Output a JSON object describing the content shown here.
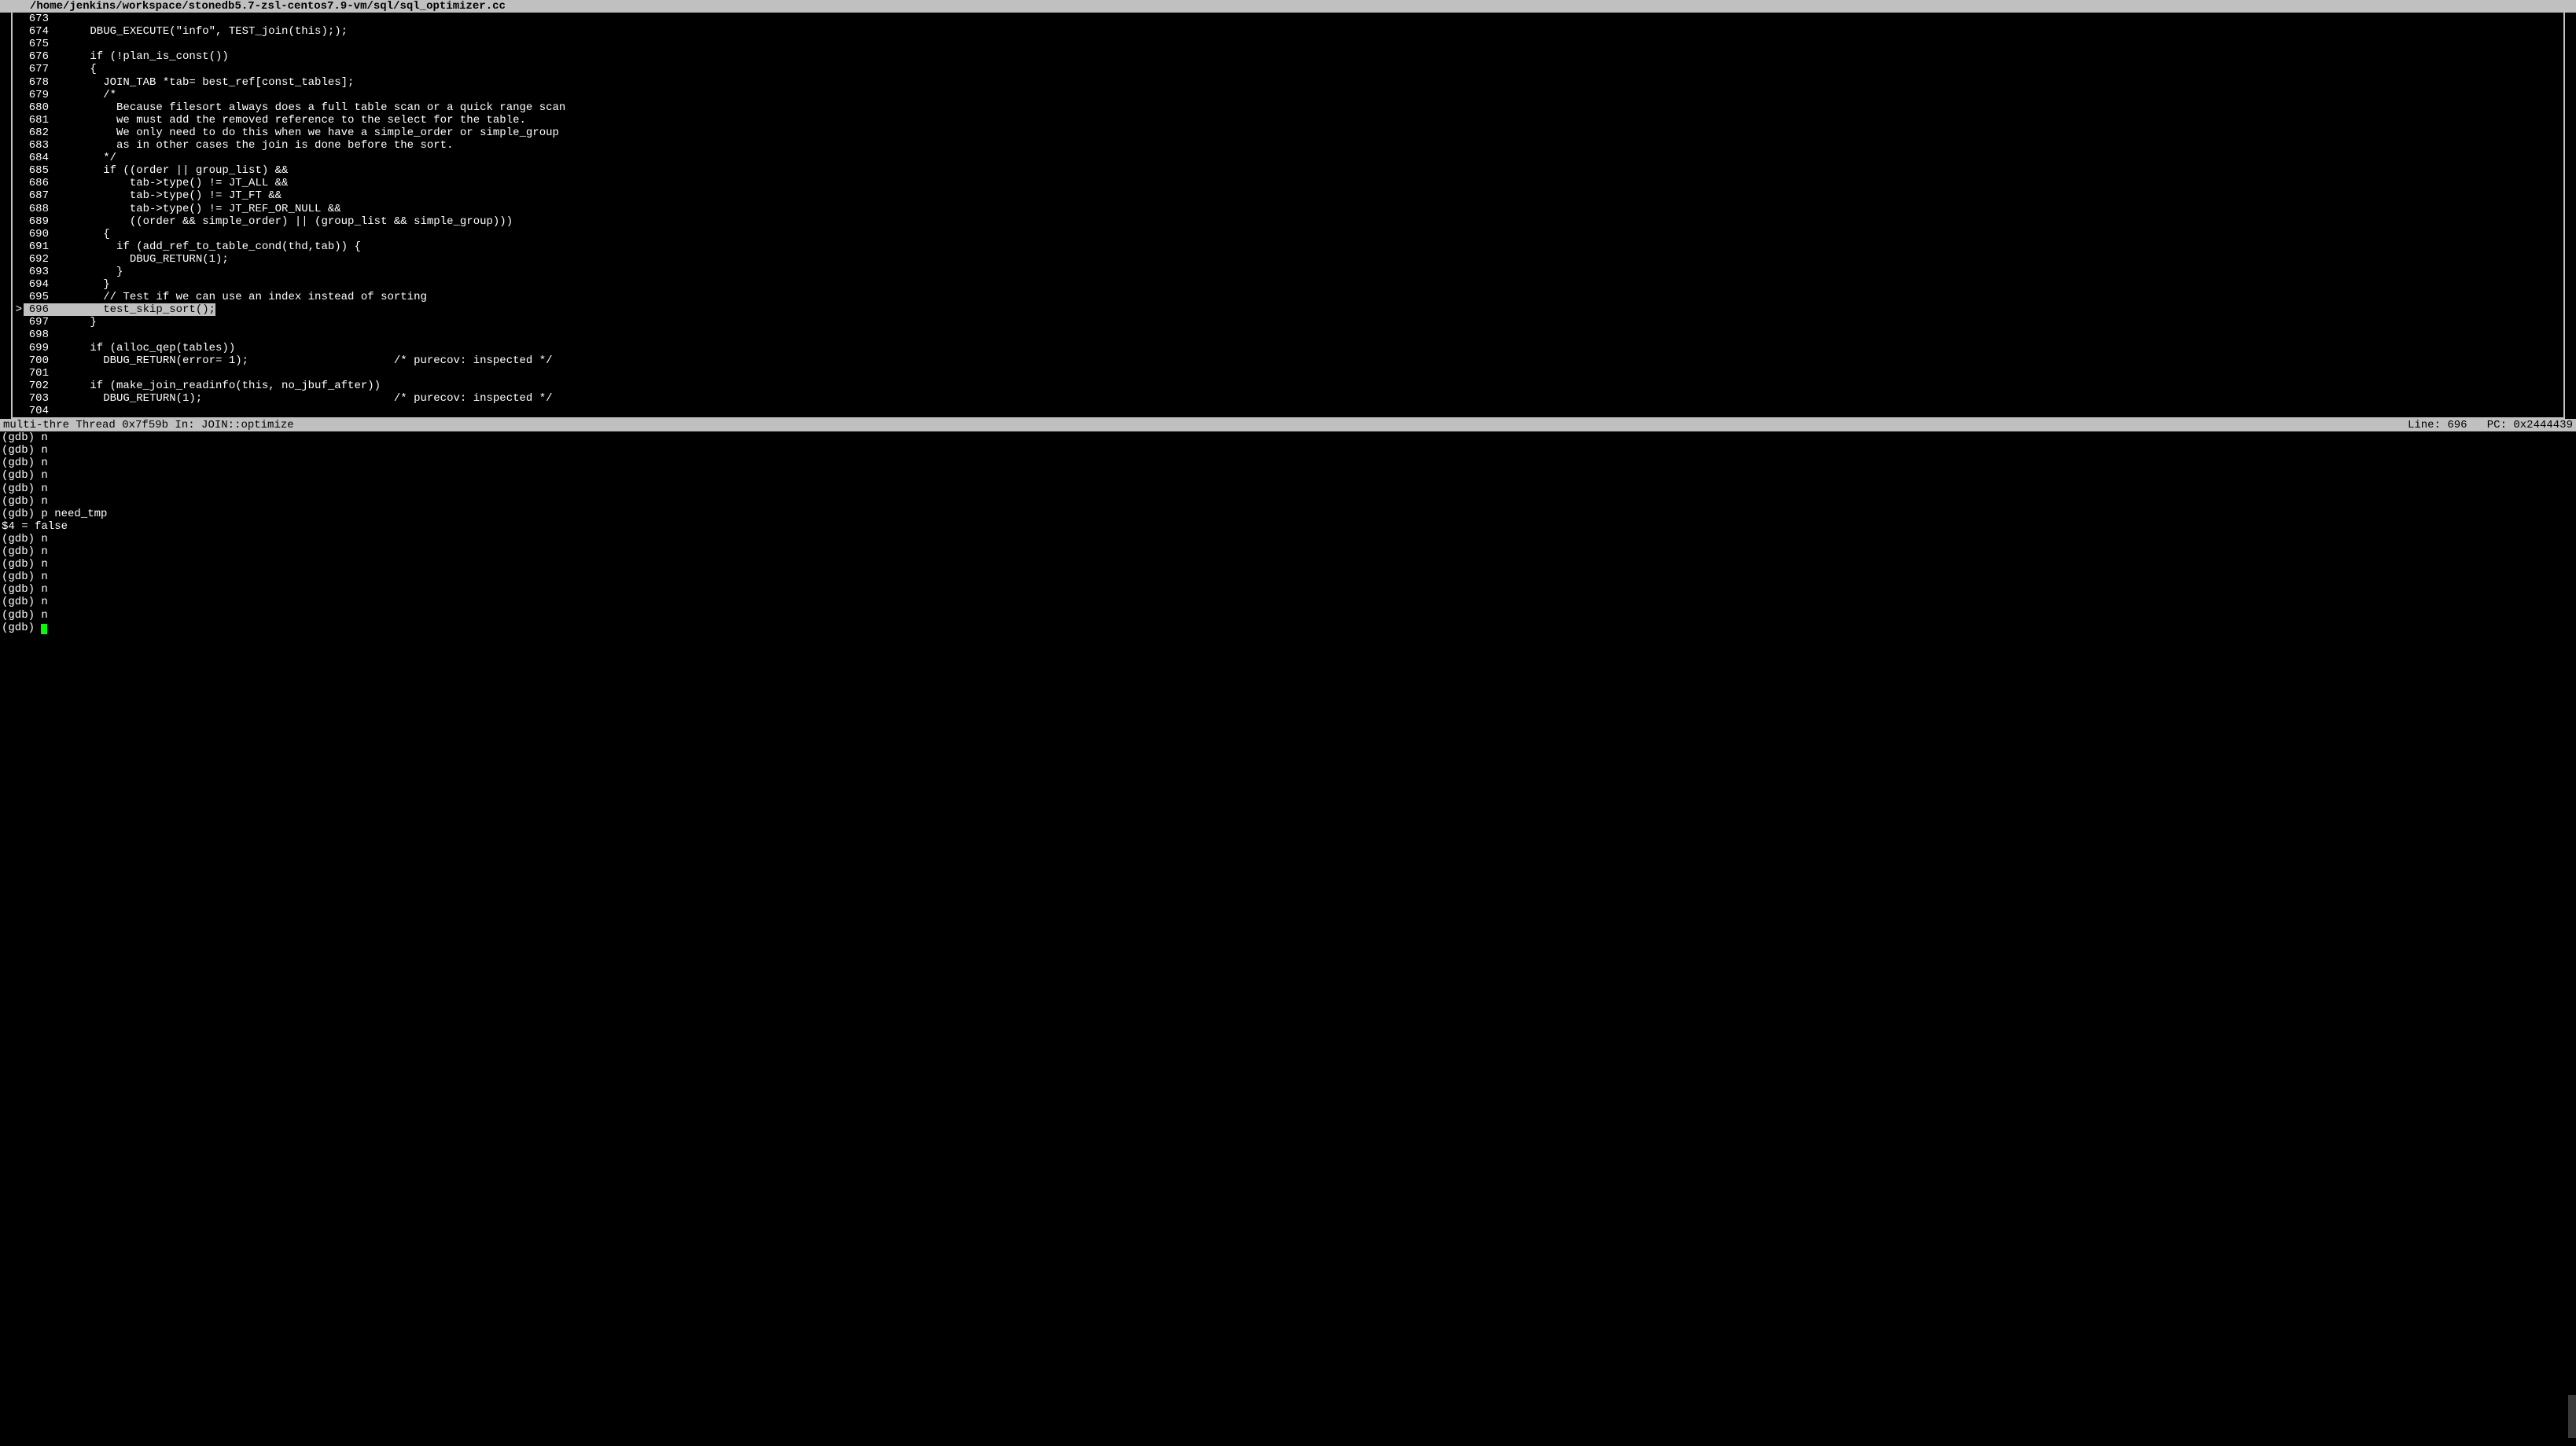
{
  "title_path": "/home/jenkins/workspace/stonedb5.7-zsl-centos7.9-vm/sql/sql_optimizer.cc",
  "status": {
    "left": "multi-thre Thread 0x7f59b In: JOIN::optimize",
    "right": "Line: 696   PC: 0x2444439"
  },
  "current_line_no": 696,
  "source": [
    {
      "n": 673,
      "t": ""
    },
    {
      "n": 674,
      "t": "    DBUG_EXECUTE(\"info\", TEST_join(this););"
    },
    {
      "n": 675,
      "t": ""
    },
    {
      "n": 676,
      "t": "    if (!plan_is_const())"
    },
    {
      "n": 677,
      "t": "    {"
    },
    {
      "n": 678,
      "t": "      JOIN_TAB *tab= best_ref[const_tables];"
    },
    {
      "n": 679,
      "t": "      /*"
    },
    {
      "n": 680,
      "t": "        Because filesort always does a full table scan or a quick range scan"
    },
    {
      "n": 681,
      "t": "        we must add the removed reference to the select for the table."
    },
    {
      "n": 682,
      "t": "        We only need to do this when we have a simple_order or simple_group"
    },
    {
      "n": 683,
      "t": "        as in other cases the join is done before the sort."
    },
    {
      "n": 684,
      "t": "      */"
    },
    {
      "n": 685,
      "t": "      if ((order || group_list) &&"
    },
    {
      "n": 686,
      "t": "          tab->type() != JT_ALL &&"
    },
    {
      "n": 687,
      "t": "          tab->type() != JT_FT &&"
    },
    {
      "n": 688,
      "t": "          tab->type() != JT_REF_OR_NULL &&"
    },
    {
      "n": 689,
      "t": "          ((order && simple_order) || (group_list && simple_group)))"
    },
    {
      "n": 690,
      "t": "      {"
    },
    {
      "n": 691,
      "t": "        if (add_ref_to_table_cond(thd,tab)) {"
    },
    {
      "n": 692,
      "t": "          DBUG_RETURN(1);"
    },
    {
      "n": 693,
      "t": "        }"
    },
    {
      "n": 694,
      "t": "      }"
    },
    {
      "n": 695,
      "t": "      // Test if we can use an index instead of sorting"
    },
    {
      "n": 696,
      "t": "      test_skip_sort();"
    },
    {
      "n": 697,
      "t": "    }"
    },
    {
      "n": 698,
      "t": ""
    },
    {
      "n": 699,
      "t": "    if (alloc_qep(tables))"
    },
    {
      "n": 700,
      "t": "      DBUG_RETURN(error= 1);                      /* purecov: inspected */"
    },
    {
      "n": 701,
      "t": ""
    },
    {
      "n": 702,
      "t": "    if (make_join_readinfo(this, no_jbuf_after))"
    },
    {
      "n": 703,
      "t": "      DBUG_RETURN(1);                             /* purecov: inspected */"
    },
    {
      "n": 704,
      "t": ""
    }
  ],
  "console": [
    "(gdb) n",
    "(gdb) n",
    "(gdb) n",
    "(gdb) n",
    "(gdb) n",
    "(gdb) n",
    "(gdb) p need_tmp",
    "$4 = false",
    "(gdb) n",
    "(gdb) n",
    "(gdb) n",
    "(gdb) n",
    "(gdb) n",
    "(gdb) n",
    "(gdb) n"
  ],
  "prompt": "(gdb) "
}
